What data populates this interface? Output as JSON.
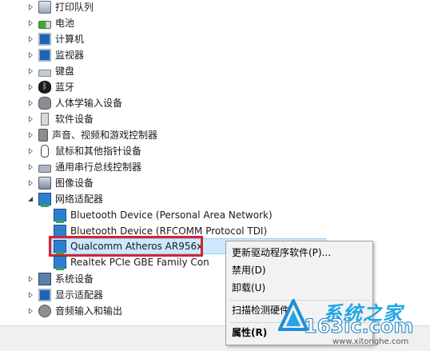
{
  "tree": {
    "items": [
      {
        "label": "打印队列",
        "icon": "printer-icon",
        "state": "collapsed"
      },
      {
        "label": "电池",
        "icon": "battery-icon",
        "state": "collapsed"
      },
      {
        "label": "计算机",
        "icon": "computer-icon",
        "state": "collapsed"
      },
      {
        "label": "监视器",
        "icon": "monitor-icon",
        "state": "collapsed"
      },
      {
        "label": "键盘",
        "icon": "keyboard-icon",
        "state": "collapsed"
      },
      {
        "label": "蓝牙",
        "icon": "bluetooth-icon",
        "state": "collapsed"
      },
      {
        "label": "人体学输入设备",
        "icon": "hid-icon",
        "state": "collapsed"
      },
      {
        "label": "软件设备",
        "icon": "software-device-icon",
        "state": "collapsed"
      },
      {
        "label": "声音、视频和游戏控制器",
        "icon": "sound-icon",
        "state": "collapsed"
      },
      {
        "label": "鼠标和其他指针设备",
        "icon": "mouse-icon",
        "state": "collapsed"
      },
      {
        "label": "通用串行总线控制器",
        "icon": "usb-icon",
        "state": "collapsed"
      },
      {
        "label": "图像设备",
        "icon": "imaging-icon",
        "state": "collapsed"
      },
      {
        "label": "网络适配器",
        "icon": "network-icon",
        "state": "expanded"
      }
    ],
    "network_children": [
      {
        "label": "Bluetooth Device (Personal Area Network)"
      },
      {
        "label": "Bluetooth Device (RFCOMM Protocol TDI)"
      },
      {
        "label": "Qualcomm Atheros AR956x"
      },
      {
        "label": "Realtek PCIe GBE Family Con"
      }
    ],
    "after_items": [
      {
        "label": "系统设备",
        "icon": "system-icon",
        "state": "collapsed"
      },
      {
        "label": "显示适配器",
        "icon": "display-adapter-icon",
        "state": "collapsed"
      },
      {
        "label": "音频输入和输出",
        "icon": "audio-io-icon",
        "state": "collapsed"
      }
    ]
  },
  "context_menu": {
    "items": [
      "更新驱动程序软件(P)...",
      "禁用(D)",
      "卸载(U)",
      "扫描检测硬件",
      "属性(R)"
    ]
  },
  "watermark": {
    "top": "系统之家",
    "mid": "163ic.com",
    "bottom": "www.xitonghe.com"
  },
  "colors": {
    "selection": "#cde8ff",
    "highlight_box": "#d6242d",
    "watermark_blue": "#22a6e6"
  }
}
